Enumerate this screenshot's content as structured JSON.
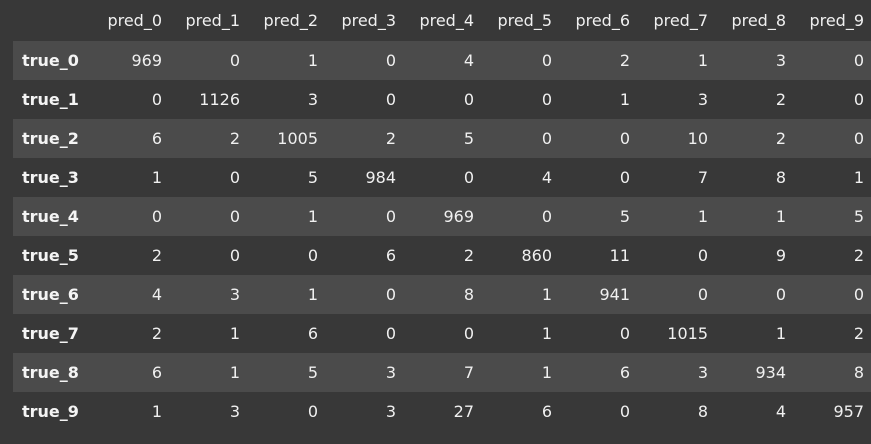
{
  "dataframe": {
    "columns": [
      "pred_0",
      "pred_1",
      "pred_2",
      "pred_3",
      "pred_4",
      "pred_5",
      "pred_6",
      "pred_7",
      "pred_8",
      "pred_9"
    ],
    "rows": [
      {
        "index": "true_0",
        "values": [
          "969",
          "0",
          "1",
          "0",
          "4",
          "0",
          "2",
          "1",
          "3",
          "0"
        ]
      },
      {
        "index": "true_1",
        "values": [
          "0",
          "1126",
          "3",
          "0",
          "0",
          "0",
          "1",
          "3",
          "2",
          "0"
        ]
      },
      {
        "index": "true_2",
        "values": [
          "6",
          "2",
          "1005",
          "2",
          "5",
          "0",
          "0",
          "10",
          "2",
          "0"
        ]
      },
      {
        "index": "true_3",
        "values": [
          "1",
          "0",
          "5",
          "984",
          "0",
          "4",
          "0",
          "7",
          "8",
          "1"
        ]
      },
      {
        "index": "true_4",
        "values": [
          "0",
          "0",
          "1",
          "0",
          "969",
          "0",
          "5",
          "1",
          "1",
          "5"
        ]
      },
      {
        "index": "true_5",
        "values": [
          "2",
          "0",
          "0",
          "6",
          "2",
          "860",
          "11",
          "0",
          "9",
          "2"
        ]
      },
      {
        "index": "true_6",
        "values": [
          "4",
          "3",
          "1",
          "0",
          "8",
          "1",
          "941",
          "0",
          "0",
          "0"
        ]
      },
      {
        "index": "true_7",
        "values": [
          "2",
          "1",
          "6",
          "0",
          "0",
          "1",
          "0",
          "1015",
          "1",
          "2"
        ]
      },
      {
        "index": "true_8",
        "values": [
          "6",
          "1",
          "5",
          "3",
          "7",
          "1",
          "6",
          "3",
          "934",
          "8"
        ]
      },
      {
        "index": "true_9",
        "values": [
          "1",
          "3",
          "0",
          "3",
          "27",
          "6",
          "0",
          "8",
          "4",
          "957"
        ]
      }
    ]
  }
}
